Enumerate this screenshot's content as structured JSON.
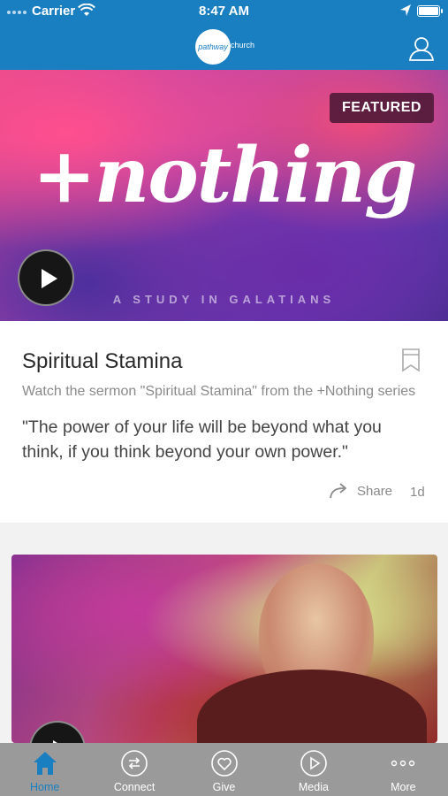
{
  "status_bar": {
    "carrier": "Carrier",
    "time": "8:47 AM"
  },
  "header": {
    "logo_text": "pathway",
    "logo_suffix": "church"
  },
  "featured": {
    "badge": "FEATURED",
    "art_title": "+nothing",
    "art_subtitle": "A STUDY IN GALATIANS"
  },
  "post": {
    "title": "Spiritual Stamina",
    "description": "Watch the sermon \"Spiritual Stamina\" from the +Nothing series",
    "quote": "\"The power of your life will be beyond what you think, if you think beyond your own power.\"",
    "share_label": "Share",
    "age": "1d"
  },
  "tabs": [
    {
      "label": "Home",
      "icon": "home-icon",
      "active": true
    },
    {
      "label": "Connect",
      "icon": "connect-icon",
      "active": false
    },
    {
      "label": "Give",
      "icon": "give-icon",
      "active": false
    },
    {
      "label": "Media",
      "icon": "media-icon",
      "active": false
    },
    {
      "label": "More",
      "icon": "more-icon",
      "active": false
    }
  ],
  "colors": {
    "brand": "#1a7fc1",
    "tabbar": "#9a9a9a"
  }
}
